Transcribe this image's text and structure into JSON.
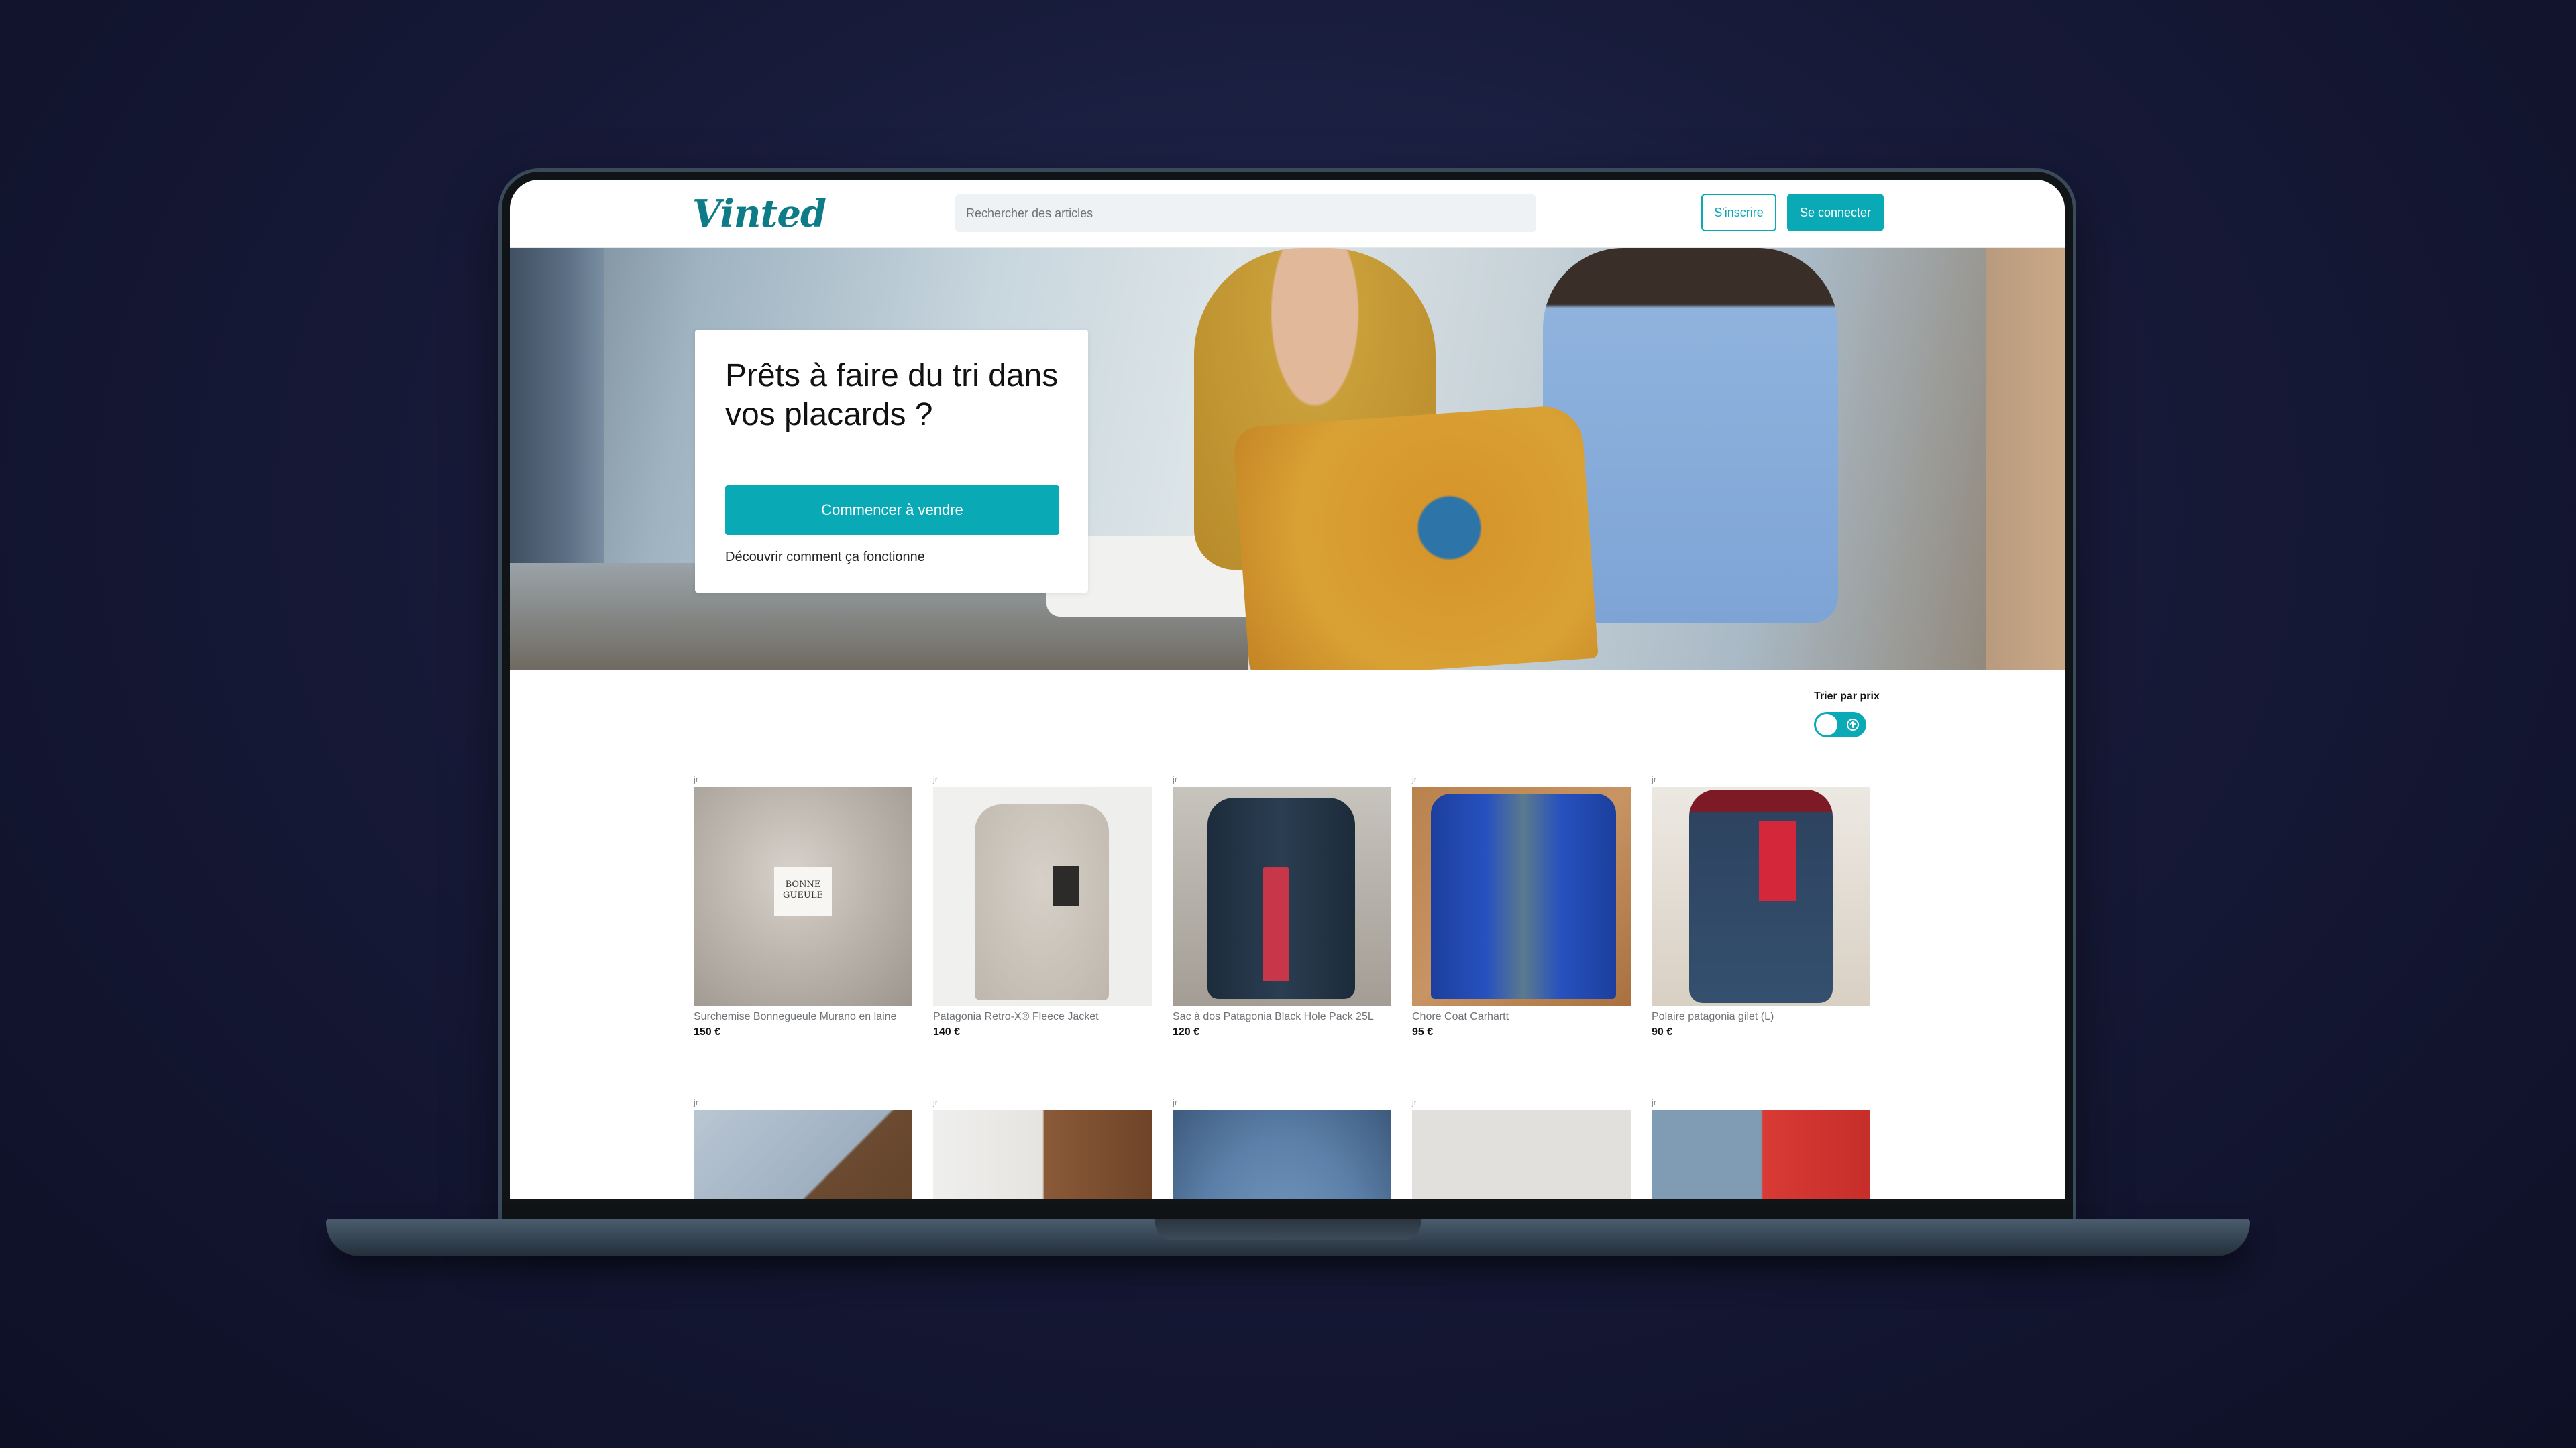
{
  "header": {
    "logo": "Vinted",
    "search_placeholder": "Rechercher des articles",
    "signup_label": "S'inscrire",
    "login_label": "Se connecter"
  },
  "hero": {
    "title": "Prêts à faire du tri dans vos placards ?",
    "cta_label": "Commencer à vendre",
    "link_label": "Découvrir comment ça fonctionne"
  },
  "sort": {
    "label": "Trier par prix",
    "toggle_on": true
  },
  "colors": {
    "brand": "#0d7b88",
    "accent": "#09aab5"
  },
  "items": [
    {
      "user": "jr",
      "title": "Surchemise Bonnegueule Murano en laine",
      "price": "150 €",
      "brand_tag": "BONNE GUEULE"
    },
    {
      "user": "jr",
      "title": "Patagonia Retro-X® Fleece Jacket",
      "price": "140 €"
    },
    {
      "user": "jr",
      "title": "Sac à dos Patagonia Black Hole Pack 25L",
      "price": "120 €"
    },
    {
      "user": "jr",
      "title": "Chore Coat Carhartt",
      "price": "95 €"
    },
    {
      "user": "jr",
      "title": "Polaire patagonia gilet (L)",
      "price": "90 €"
    },
    {
      "user": "jr"
    },
    {
      "user": "jr"
    },
    {
      "user": "jr"
    },
    {
      "user": "jr"
    },
    {
      "user": "jr"
    }
  ]
}
